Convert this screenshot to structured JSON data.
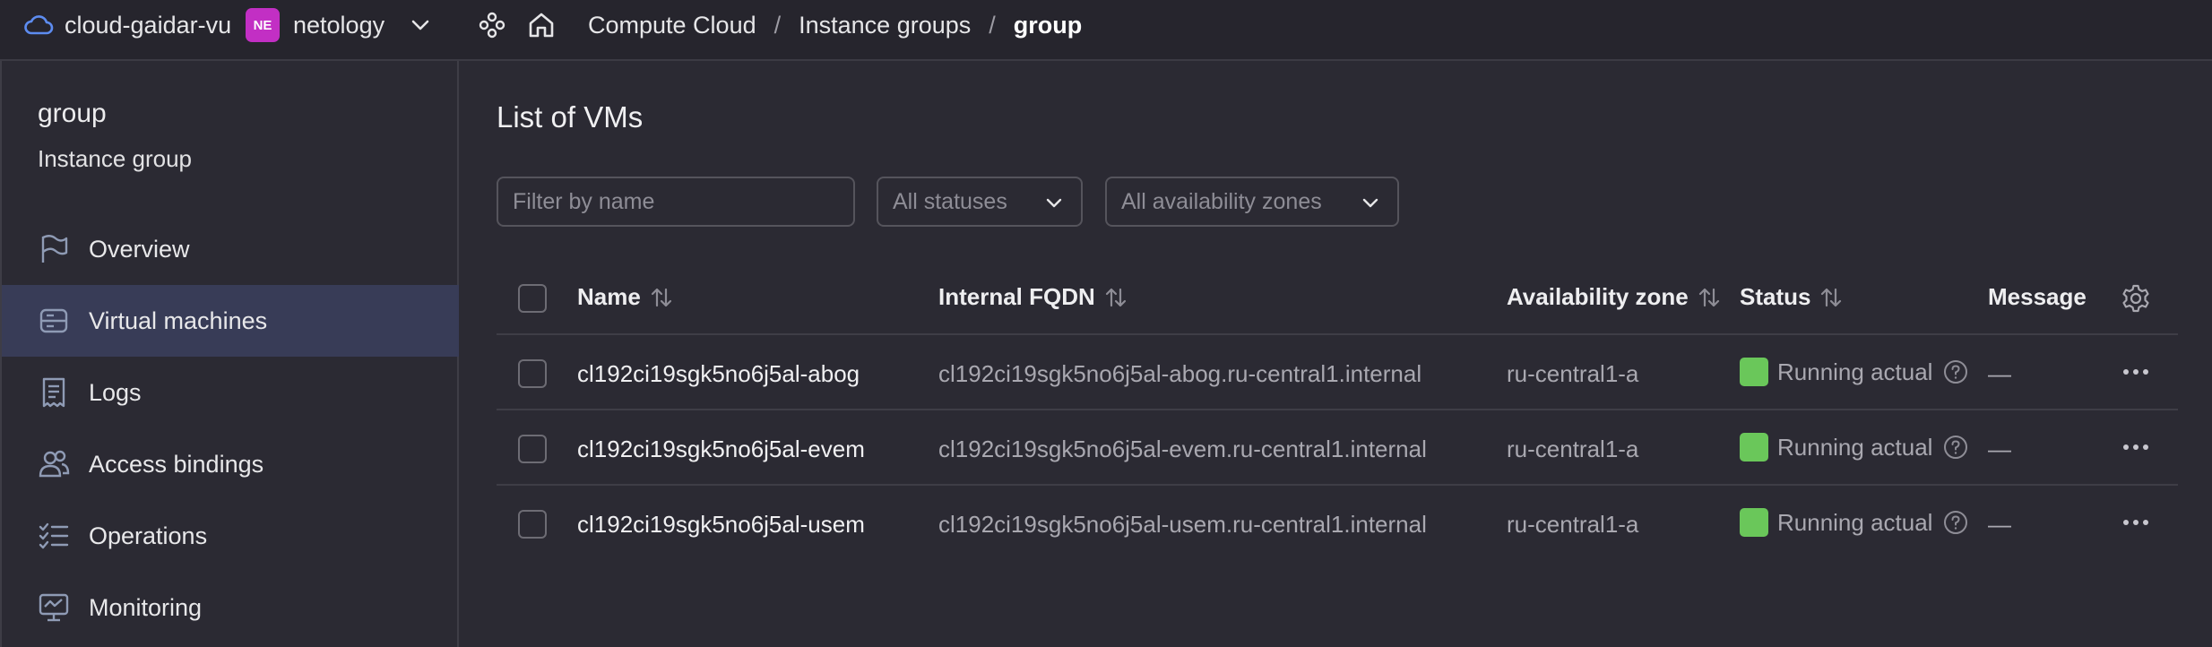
{
  "topbar": {
    "cloud_name": "cloud-gaidar-vu",
    "org_badge": "NE",
    "org_name": "netology",
    "breadcrumbs": [
      "Compute Cloud",
      "Instance groups",
      "group"
    ],
    "separator": "/"
  },
  "sidebar": {
    "title": "group",
    "subtitle": "Instance group",
    "items": [
      {
        "label": "Overview",
        "icon": "flag-icon",
        "active": false
      },
      {
        "label": "Virtual machines",
        "icon": "server-icon",
        "active": true
      },
      {
        "label": "Logs",
        "icon": "receipt-icon",
        "active": false
      },
      {
        "label": "Access bindings",
        "icon": "users-icon",
        "active": false
      },
      {
        "label": "Operations",
        "icon": "checklist-icon",
        "active": false
      },
      {
        "label": "Monitoring",
        "icon": "monitor-icon",
        "active": false
      }
    ]
  },
  "main": {
    "title": "List of VMs",
    "filter_placeholder": "Filter by name",
    "status_select": "All statuses",
    "zone_select": "All availability zones",
    "columns": [
      "Name",
      "Internal FQDN",
      "Availability zone",
      "Status",
      "Message"
    ],
    "rows": [
      {
        "name": "cl192ci19sgk5no6j5al-abog",
        "fqdn": "cl192ci19sgk5no6j5al-abog.ru-central1.internal",
        "zone": "ru-central1-a",
        "status": "Running actual",
        "message": "—"
      },
      {
        "name": "cl192ci19sgk5no6j5al-evem",
        "fqdn": "cl192ci19sgk5no6j5al-evem.ru-central1.internal",
        "zone": "ru-central1-a",
        "status": "Running actual",
        "message": "—"
      },
      {
        "name": "cl192ci19sgk5no6j5al-usem",
        "fqdn": "cl192ci19sgk5no6j5al-usem.ru-central1.internal",
        "zone": "ru-central1-a",
        "status": "Running actual",
        "message": "—"
      }
    ]
  },
  "colors": {
    "background": "#2b2a33",
    "active_nav": "#383c57",
    "status_running": "#6ac75a",
    "badge": "#c22fc4",
    "cloud_icon": "#5d8cf0"
  }
}
